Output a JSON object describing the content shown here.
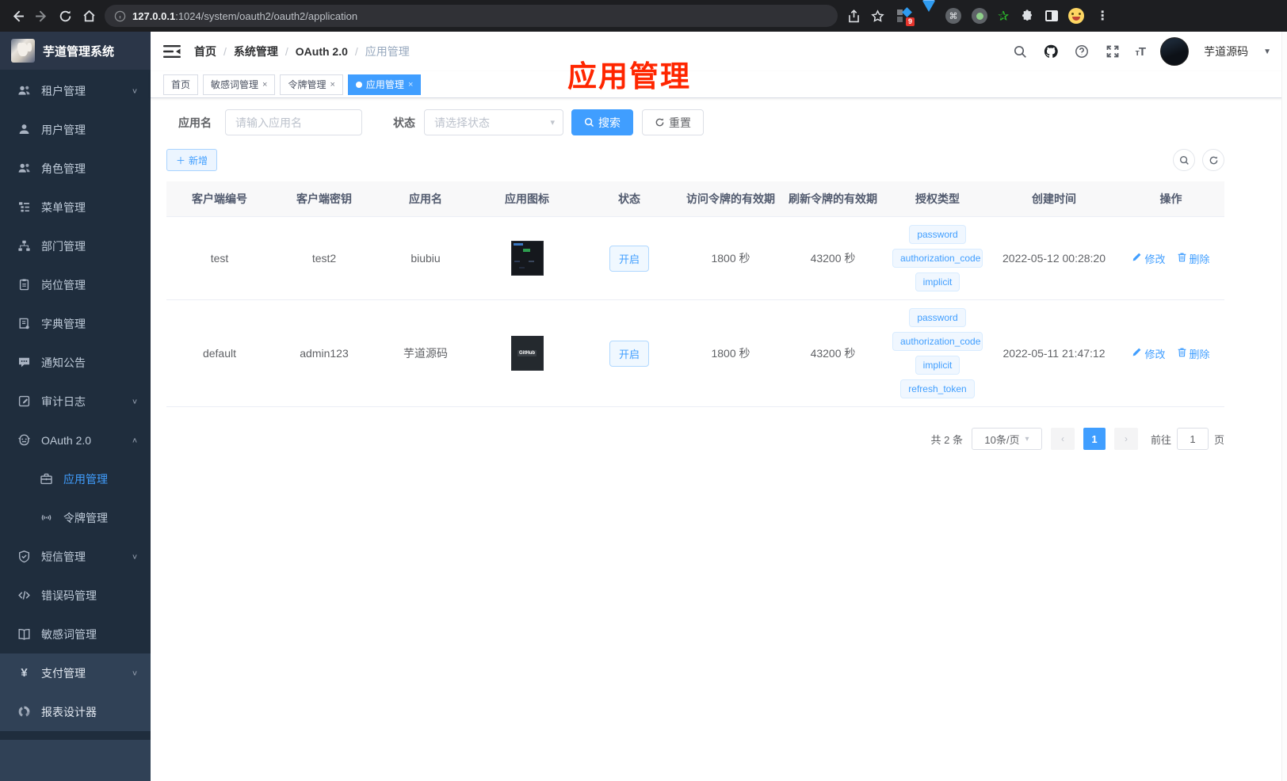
{
  "browser": {
    "url_host": "127.0.0.1",
    "url_rest": ":1024/system/oauth2/oauth2/application",
    "extension_badge": "9",
    "icons": [
      "back-icon",
      "forward-icon",
      "reload-icon",
      "home-icon",
      "info-icon",
      "share-icon",
      "star-icon",
      "extension-badge-icon",
      "kite-icon",
      "command-circle-icon",
      "record-circle-icon",
      "green-star-icon",
      "puzzle-icon",
      "split-view-icon",
      "emoji-avatar-icon",
      "menu-dots-icon"
    ]
  },
  "app": {
    "title": "芋道管理系统"
  },
  "sidebar": {
    "items": [
      {
        "key": "tenant",
        "icon": "users-icon",
        "label": "租户管理",
        "chevron": "down",
        "group": "sub"
      },
      {
        "key": "user",
        "icon": "user-icon",
        "label": "用户管理",
        "group": "sub"
      },
      {
        "key": "role",
        "icon": "role-icon",
        "label": "角色管理",
        "group": "sub"
      },
      {
        "key": "menu",
        "icon": "menu-tree-icon",
        "label": "菜单管理",
        "group": "sub"
      },
      {
        "key": "dept",
        "icon": "dept-icon",
        "label": "部门管理",
        "group": "sub"
      },
      {
        "key": "post",
        "icon": "post-icon",
        "label": "岗位管理",
        "group": "sub"
      },
      {
        "key": "dict",
        "icon": "dict-icon",
        "label": "字典管理",
        "group": "sub"
      },
      {
        "key": "notice",
        "icon": "notice-icon",
        "label": "通知公告",
        "group": "sub"
      },
      {
        "key": "audit",
        "icon": "audit-icon",
        "label": "审计日志",
        "chevron": "down",
        "group": "sub"
      },
      {
        "key": "oauth2",
        "icon": "oauth-icon",
        "label": "OAuth 2.0",
        "chevron": "up",
        "group": "sub"
      },
      {
        "key": "oauth2-app",
        "icon": "briefcase-icon",
        "label": "应用管理",
        "group": "sub2",
        "active": true
      },
      {
        "key": "oauth2-token",
        "icon": "signal-icon",
        "label": "令牌管理",
        "group": "sub2"
      },
      {
        "key": "sms",
        "icon": "shield-icon",
        "label": "短信管理",
        "chevron": "down",
        "group": "sub"
      },
      {
        "key": "errcode",
        "icon": "code-icon",
        "label": "错误码管理",
        "group": "sub"
      },
      {
        "key": "sensitive",
        "icon": "book-open-icon",
        "label": "敏感词管理",
        "group": "sub"
      },
      {
        "key": "pay",
        "icon": "yen-icon",
        "label": "支付管理",
        "chevron": "down",
        "group": "top"
      },
      {
        "key": "report",
        "icon": "report-icon",
        "label": "报表设计器",
        "group": "top"
      }
    ]
  },
  "navbar": {
    "breadcrumb": [
      "首页",
      "系统管理",
      "OAuth 2.0",
      "应用管理"
    ],
    "action_icons": [
      "search-icon",
      "github-icon",
      "help-icon",
      "fullscreen-icon",
      "font-size-icon"
    ],
    "username": "芋道源码"
  },
  "tags_view": {
    "tabs": [
      {
        "label": "首页",
        "closable": false,
        "active": false
      },
      {
        "label": "敏感词管理",
        "closable": true,
        "active": false
      },
      {
        "label": "令牌管理",
        "closable": true,
        "active": false
      },
      {
        "label": "应用管理",
        "closable": true,
        "active": true
      }
    ]
  },
  "annotation": {
    "text": "应用管理"
  },
  "filters": {
    "app_name_label": "应用名",
    "app_name_placeholder": "请输入应用名",
    "status_label": "状态",
    "status_placeholder": "请选择状态",
    "search_label": "搜索",
    "reset_label": "重置"
  },
  "toolbar": {
    "add_label": "新增"
  },
  "table": {
    "headers": [
      "客户端编号",
      "客户端密钥",
      "应用名",
      "应用图标",
      "状态",
      "访问令牌的有效期",
      "刷新令牌的有效期",
      "授权类型",
      "创建时间",
      "操作"
    ],
    "edit_label": "修改",
    "delete_label": "删除",
    "rows": [
      {
        "client_id": "test",
        "secret": "test2",
        "name": "biubiu",
        "icon": "dashboard-thumb",
        "status": "开启",
        "access_ttl": "1800 秒",
        "refresh_ttl": "43200 秒",
        "grant_types": [
          "password",
          "authorization_code",
          "implicit"
        ],
        "created": "2022-05-12 00:28:20"
      },
      {
        "client_id": "default",
        "secret": "admin123",
        "name": "芋道源码",
        "icon": "github-thumb",
        "status": "开启",
        "access_ttl": "1800 秒",
        "refresh_ttl": "43200 秒",
        "grant_types": [
          "password",
          "authorization_code",
          "implicit",
          "refresh_token"
        ],
        "created": "2022-05-11 21:47:12"
      }
    ]
  },
  "pagination": {
    "total_text": "共 2 条",
    "page_size": "10条/页",
    "current_page": "1",
    "goto_label": "前往",
    "goto_value": "1",
    "page_unit": "页"
  },
  "colors": {
    "accent": "#409eff",
    "sidebar_bg": "#304156",
    "submenu_bg": "#1f2d3d",
    "active_text": "#409eff",
    "annotation": "#ff2600"
  }
}
